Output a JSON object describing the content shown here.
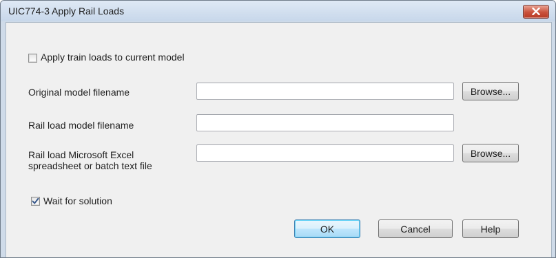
{
  "window": {
    "title": "UIC774-3 Apply Rail Loads",
    "close_icon": "close-x-icon"
  },
  "form": {
    "apply_train_loads": {
      "label": "Apply train loads to current model",
      "checked": false
    },
    "original_model": {
      "label": "Original model filename",
      "value": "",
      "browse_label": "Browse..."
    },
    "rail_load_model": {
      "label": "Rail load model filename",
      "value": ""
    },
    "rail_load_excel": {
      "label_line1": "Rail load Microsoft Excel",
      "label_line2": "spreadsheet or batch text file",
      "value": "",
      "browse_label": "Browse..."
    },
    "wait_for_solution": {
      "label": "Wait for solution",
      "checked": true
    }
  },
  "buttons": {
    "ok": "OK",
    "cancel": "Cancel",
    "help": "Help"
  },
  "colors": {
    "titlebar": "#c7d7ea",
    "client_bg": "#f0f0f0",
    "close_button": "#c9503b",
    "default_button_border": "#3c7fb1",
    "checkmark": "#3a5a8c"
  }
}
